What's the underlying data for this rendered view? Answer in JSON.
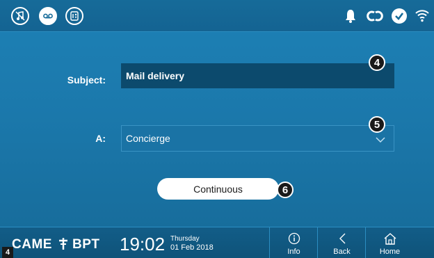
{
  "statusbar": {
    "left_icons": [
      "music-note-mute-icon",
      "voicemail-icon",
      "intercom-icon"
    ],
    "right_icons": [
      "bell-icon",
      "link-icon",
      "check-icon",
      "wifi-icon"
    ]
  },
  "form": {
    "subject_label": "Subject:",
    "subject_value": "Mail delivery",
    "recipient_label": "A:",
    "recipient_value": "Concierge",
    "repeat_button": "Continuous"
  },
  "callouts": {
    "subject": "4",
    "recipient": "5",
    "repeat": "6",
    "figure": "4"
  },
  "footer": {
    "brand_left": "CAME",
    "brand_right": "BPT",
    "time": "19:02",
    "day": "Thursday",
    "date": "01 Feb 2018",
    "info_label": "Info",
    "back_label": "Back",
    "home_label": "Home"
  },
  "colors": {
    "background": "#1b78ab",
    "field_dark": "#0c4a6d",
    "callout": "#1a1a1a",
    "button": "#ffffff"
  }
}
